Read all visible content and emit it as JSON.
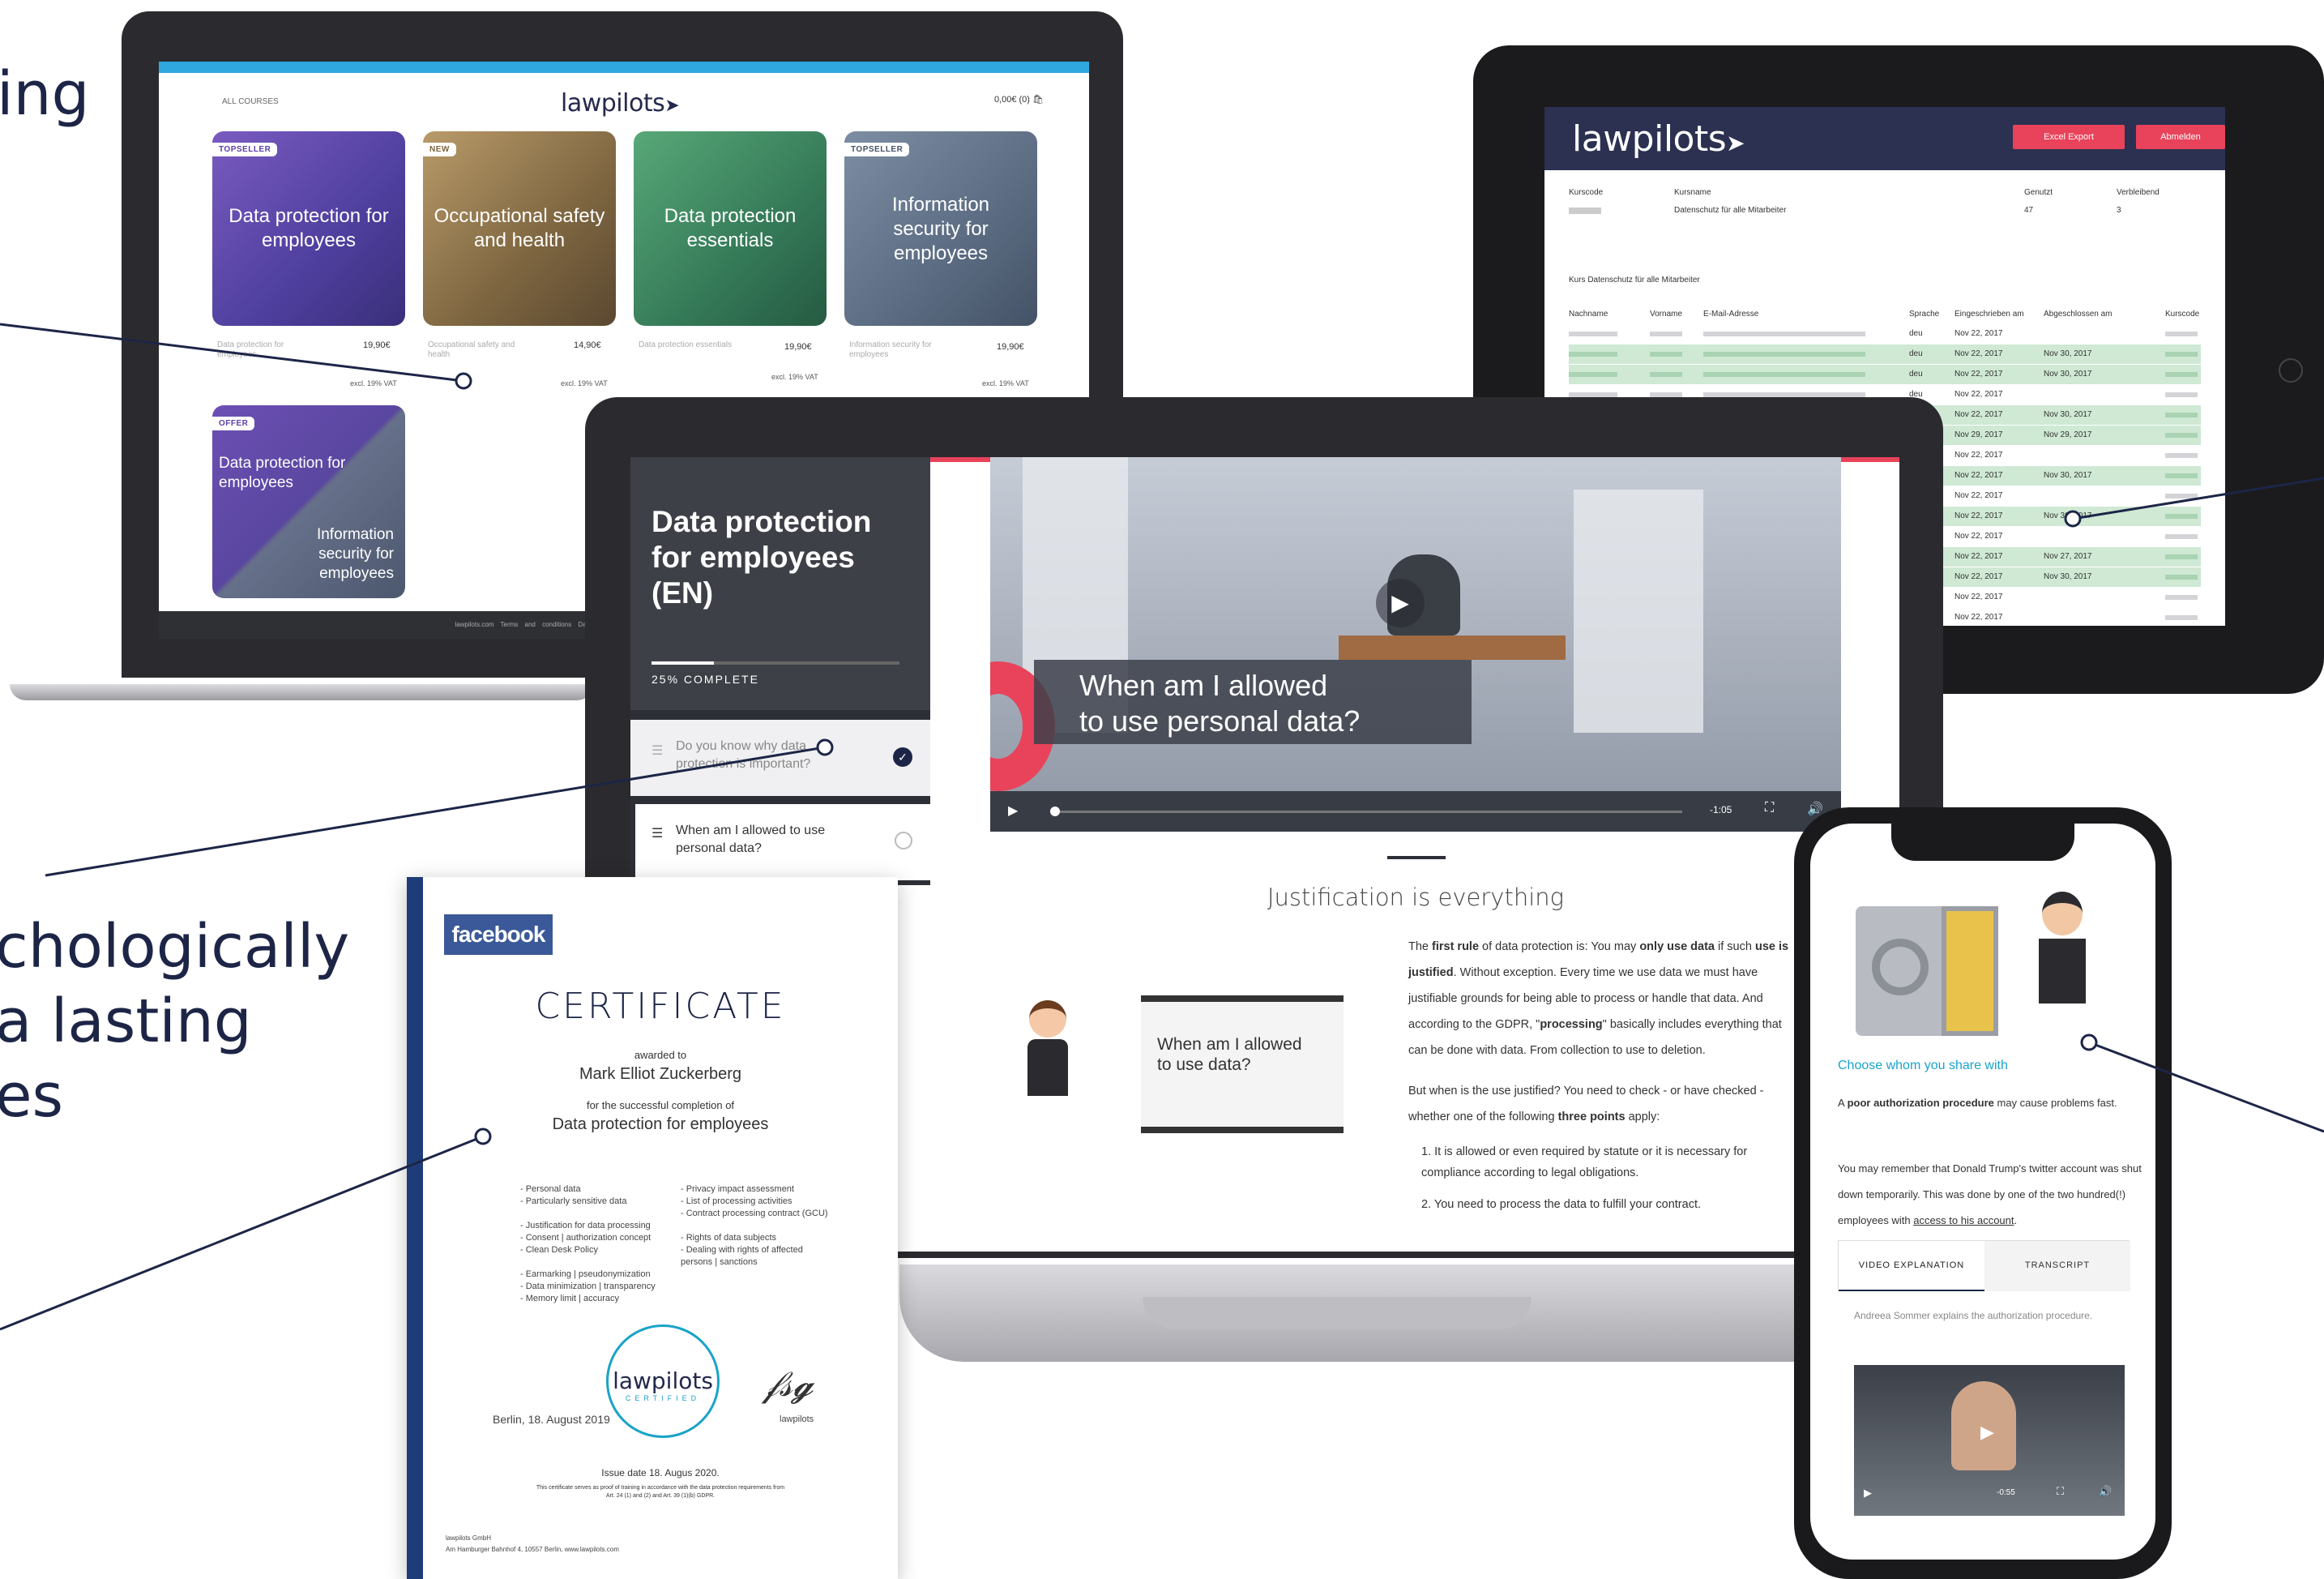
{
  "headline_top": "ing",
  "headline_mid": [
    "chologically",
    "a lasting",
    "es"
  ],
  "lap1": {
    "all_courses": "ALL COURSES",
    "logo": "lawpilots",
    "cart": "0,00€ (0)",
    "cards": [
      {
        "tag": "TOPSELLER",
        "title": "Data protection for employees",
        "sub": "Data protection for employees",
        "price": "19,90€",
        "vat": "excl. 19% VAT"
      },
      {
        "tag": "NEW",
        "title": "Occupational safety and health",
        "sub": "Occupational safety and health",
        "price": "14,90€",
        "vat": "excl. 19% VAT"
      },
      {
        "tag": "",
        "title": "Data protection essentials",
        "sub": "Data protection essentials",
        "price": "19,90€",
        "vat": "excl. 19% VAT"
      },
      {
        "tag": "TOPSELLER",
        "title": "Information security for employees",
        "sub": "Information security for employees",
        "price": "19,90€",
        "vat": "excl. 19% VAT"
      }
    ],
    "offer": {
      "tag": "OFFER",
      "title_a": "Data protection for employees",
      "title_b": "Information security for employees"
    },
    "footer": "lawpilots.com  Terms and conditions  Data protection  Legal notice  Deutsch  Français  Italiano  Español"
  },
  "tablet": {
    "logo": "lawpilots",
    "excel": "Excel Export",
    "logout": "Abmelden",
    "summary_headers": [
      "Kurscode",
      "Kursname",
      "Genutzt",
      "Verbleibend"
    ],
    "summary_values": [
      "",
      "Datenschutz für alle Mitarbeiter",
      "47",
      "3"
    ],
    "course_label": "Kurs Datenschutz für alle Mitarbeiter",
    "headers": [
      "Nachname",
      "Vorname",
      "E-Mail-Adresse",
      "Sprache",
      "Eingeschrieben am",
      "Abgeschlossen am",
      "Kurscode"
    ],
    "rows": [
      {
        "lang": "deu",
        "enrolled": "Nov 22, 2017",
        "done": "",
        "green": false
      },
      {
        "lang": "deu",
        "enrolled": "Nov 22, 2017",
        "done": "Nov 30, 2017",
        "green": true
      },
      {
        "lang": "deu",
        "enrolled": "Nov 22, 2017",
        "done": "Nov 30, 2017",
        "green": true
      },
      {
        "lang": "deu",
        "enrolled": "Nov 22, 2017",
        "done": "",
        "green": false
      },
      {
        "lang": "",
        "enrolled": "Nov 22, 2017",
        "done": "Nov 30, 2017",
        "green": true
      },
      {
        "lang": "",
        "enrolled": "Nov 29, 2017",
        "done": "Nov 29, 2017",
        "green": true
      },
      {
        "lang": "",
        "enrolled": "Nov 22, 2017",
        "done": "",
        "green": false
      },
      {
        "lang": "",
        "enrolled": "Nov 22, 2017",
        "done": "Nov 30, 2017",
        "green": true
      },
      {
        "lang": "",
        "enrolled": "Nov 22, 2017",
        "done": "",
        "green": false
      },
      {
        "lang": "",
        "enrolled": "Nov 22, 2017",
        "done": "Nov 30, 2017",
        "green": true
      },
      {
        "lang": "",
        "enrolled": "Nov 22, 2017",
        "done": "",
        "green": false
      },
      {
        "lang": "",
        "enrolled": "Nov 22, 2017",
        "done": "Nov 27, 2017",
        "green": true
      },
      {
        "lang": "",
        "enrolled": "Nov 22, 2017",
        "done": "Nov 30, 2017",
        "green": true
      },
      {
        "lang": "",
        "enrolled": "Nov 22, 2017",
        "done": "",
        "green": false
      },
      {
        "lang": "",
        "enrolled": "Nov 22, 2017",
        "done": "",
        "green": false
      }
    ]
  },
  "lap2": {
    "course_title": "Data protection for employees (EN)",
    "progress_label": "25% COMPLETE",
    "progress": 0.25,
    "lesson1": "Do you know why data protection is important?",
    "lesson2": "When am I allowed to use personal data?",
    "video_caption_line1": "When am I allowed",
    "video_caption_line2": "to use personal data?",
    "video_time": "-1:05",
    "section_title": "Justification is everything",
    "board_text": "When am I allowed to use data?",
    "para1_a": "The ",
    "para1_b": "first rule",
    "para1_c": " of data protection is: You may ",
    "para1_d": "only use data",
    "para1_e": " if such ",
    "para1_f": "use is justified",
    "para1_g": ". Without exception. Every time we use data we must have justifiable grounds for being able to process or handle that data. And according to the GDPR, \"",
    "para1_h": "processing",
    "para1_i": "\" basically includes everything that can be done with data. From collection to use to deletion.",
    "para2_a": "But when is the use justified? You need to check - or have checked - whether one of the following ",
    "para2_b": "three points",
    "para2_c": " apply:",
    "point1": "1. It is allowed or even required by statute or it is necessary for compliance according to legal obligations.",
    "point2": "2. You need to process the data to fulfill your contract."
  },
  "phone": {
    "heading": "Choose whom you share with",
    "p1_a": "A ",
    "p1_b": "poor authorization procedure",
    "p1_c": " may cause problems fast.",
    "p2_a": "You may remember that Donald Trump's twitter account was shut down temporarily. This was done by one of the two hundred(!) employees  with ",
    "p2_link": "access to his account",
    "p2_c": ".",
    "tab1": "VIDEO EXPLANATION",
    "tab2": "TRANSCRIPT",
    "explain": "Andreea Sommer explains the authorization procedure.",
    "time": "-0:55"
  },
  "cert": {
    "brand": "facebook",
    "title": "CERTIFICATE",
    "awarded": "awarded to",
    "name": "Mark Elliot Zuckerberg",
    "for": "for the successful completion of",
    "course": "Data protection for employees",
    "left_topics": [
      "- Personal data",
      "- Particularly sensitive data",
      "",
      "- Justification for data processing",
      "- Consent | authorization concept",
      "- Clean Desk Policy",
      "",
      "- Earmarking | pseudonymization",
      "- Data minimization | transparency",
      "- Memory limit | accuracy"
    ],
    "right_topics": [
      "- Privacy impact assessment",
      "- List of processing activities",
      "- Contract processing contract (GCU)",
      "",
      "- Rights of data subjects",
      "- Dealing with rights of affected",
      "  persons | sanctions"
    ],
    "seal_name": "lawpilots",
    "seal_sub": "CERTIFIED",
    "place_date": "Berlin, 18. August 2019",
    "sign_label": "lawpilots",
    "issue": "Issue date 18. Augus 2020.",
    "fine1": "This certificate serves as proof of training in accordance with the data protection requirements from",
    "fine2": "Art. 24 (1) and (2) and Art. 39 (1)(b) GDPR.",
    "company": "lawpilots GmbH",
    "address": "Am Hamburger Bahnhof 4, 10557 Berlin, www.lawpilots.com"
  },
  "colors": {
    "navy": "#1d2547",
    "accent_red": "#e8435a",
    "teal": "#1aa3c8",
    "green_row": "#cfe9d4",
    "cert_blue": "#1e3c78"
  }
}
